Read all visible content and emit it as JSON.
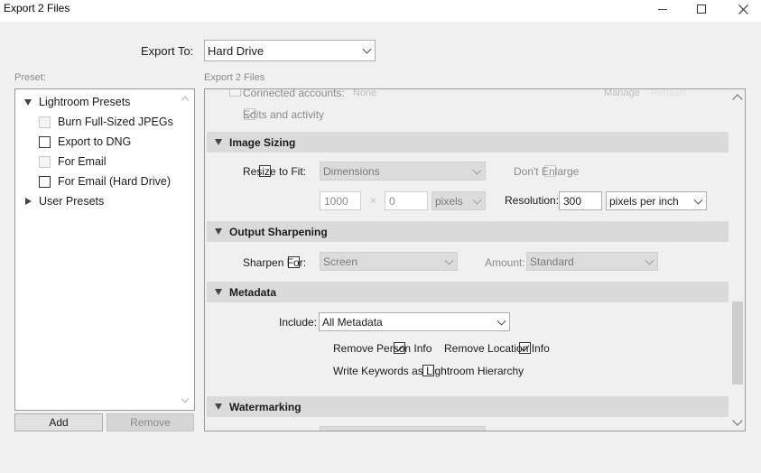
{
  "window": {
    "title": "Export 2 Files",
    "minimize_icon": "minimize-icon",
    "maximize_icon": "maximize-icon",
    "close_icon": "close-icon"
  },
  "export_to": {
    "label": "Export To:",
    "value": "Hard Drive"
  },
  "preset": {
    "label": "Preset:",
    "groups": [
      {
        "label": "Lightroom Presets",
        "expanded": true,
        "items": [
          {
            "label": "Burn Full-Sized JPEGs",
            "enabled": false
          },
          {
            "label": "Export to DNG",
            "enabled": true
          },
          {
            "label": "For Email",
            "enabled": false
          },
          {
            "label": "For Email (Hard Drive)",
            "enabled": true
          }
        ]
      },
      {
        "label": "User Presets",
        "expanded": false
      }
    ],
    "add_label": "Add",
    "remove_label": "Remove"
  },
  "settings_label": "Export 2 Files",
  "social": {
    "connected_label": "Connected accounts:",
    "connected_value": "None",
    "manage_label": "Manage",
    "refresh_label": "Refresh",
    "edits_label": "Edits and activity",
    "edits_checked": true
  },
  "image_sizing": {
    "header": "Image Sizing",
    "resize_label": "Resize to Fit:",
    "resize_checked": false,
    "resize_mode": "Dimensions",
    "dont_enlarge_label": "Don't Enlarge",
    "width": "1000",
    "times": "×",
    "height": "0",
    "units": "pixels",
    "resolution_label": "Resolution:",
    "resolution": "300",
    "resolution_units": "pixels per inch"
  },
  "output_sharpening": {
    "header": "Output Sharpening",
    "sharpen_label": "Sharpen For:",
    "sharpen_checked": false,
    "sharpen_for": "Screen",
    "amount_label": "Amount:",
    "amount": "Standard"
  },
  "metadata": {
    "header": "Metadata",
    "include_label": "Include:",
    "include_value": "All Metadata",
    "remove_person_label": "Remove Person Info",
    "remove_person_checked": true,
    "remove_location_label": "Remove Location Info",
    "remove_location_checked": true,
    "keywords_label": "Write Keywords as Lightroom Hierarchy",
    "keywords_checked": false
  },
  "watermarking": {
    "header": "Watermarking"
  }
}
